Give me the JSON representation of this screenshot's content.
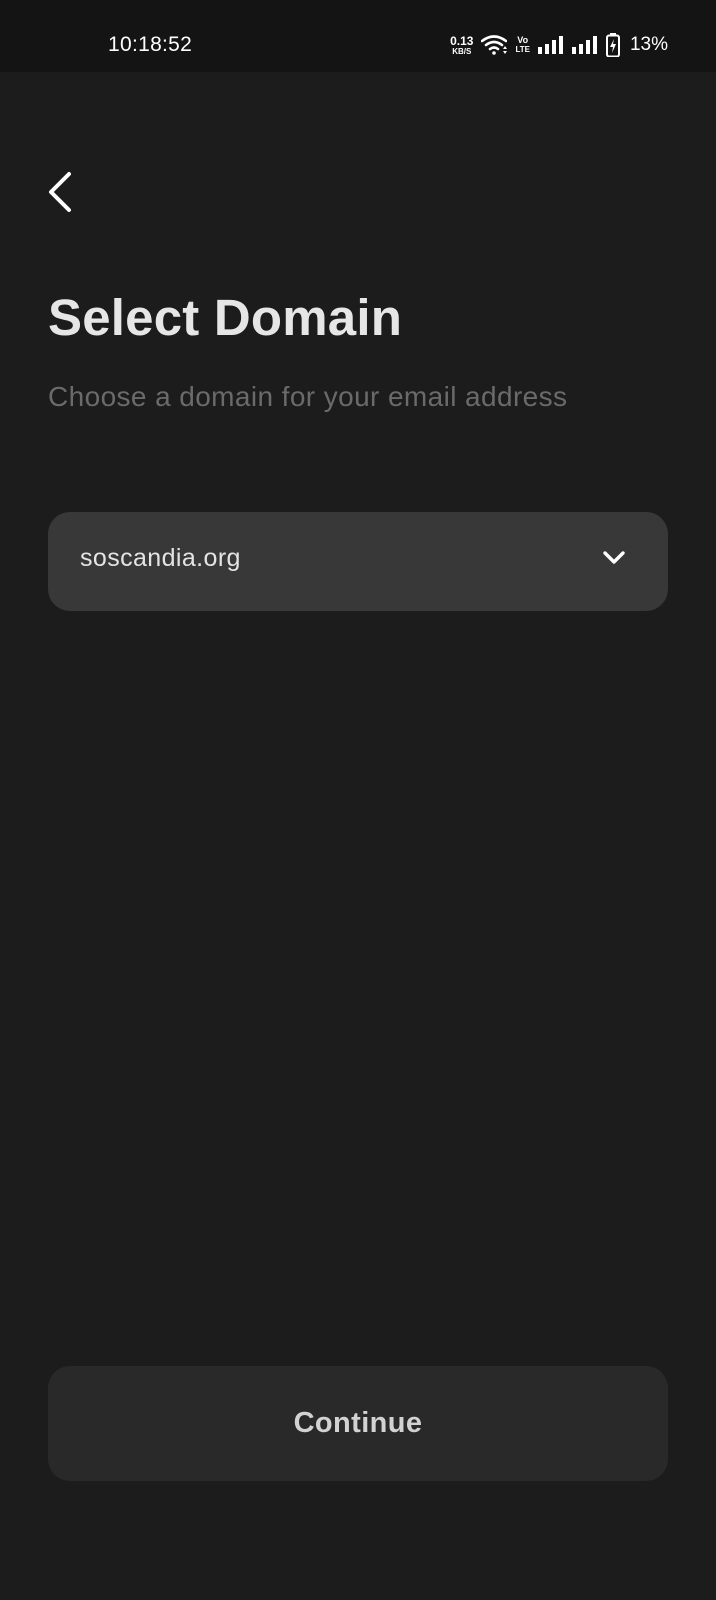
{
  "status_bar": {
    "time": "10:18:52",
    "net_speed_value": "0.13",
    "net_speed_unit": "KB/S",
    "volte_top": "Vo",
    "volte_bottom": "LTE",
    "battery_percent": "13%"
  },
  "header": {
    "back_icon": "chevron-left-icon"
  },
  "page": {
    "title": "Select Domain",
    "subtitle": "Choose a domain for your email address"
  },
  "domain_select": {
    "selected": "soscandia.org",
    "icon": "chevron-down-icon"
  },
  "continue_button": {
    "label": "Continue"
  },
  "colors": {
    "background": "#1c1c1c",
    "status_bar": "#141414",
    "select_bg": "#383838",
    "button_bg": "#292929",
    "title": "#e6e6e6",
    "subtitle": "#6a6a6a"
  }
}
